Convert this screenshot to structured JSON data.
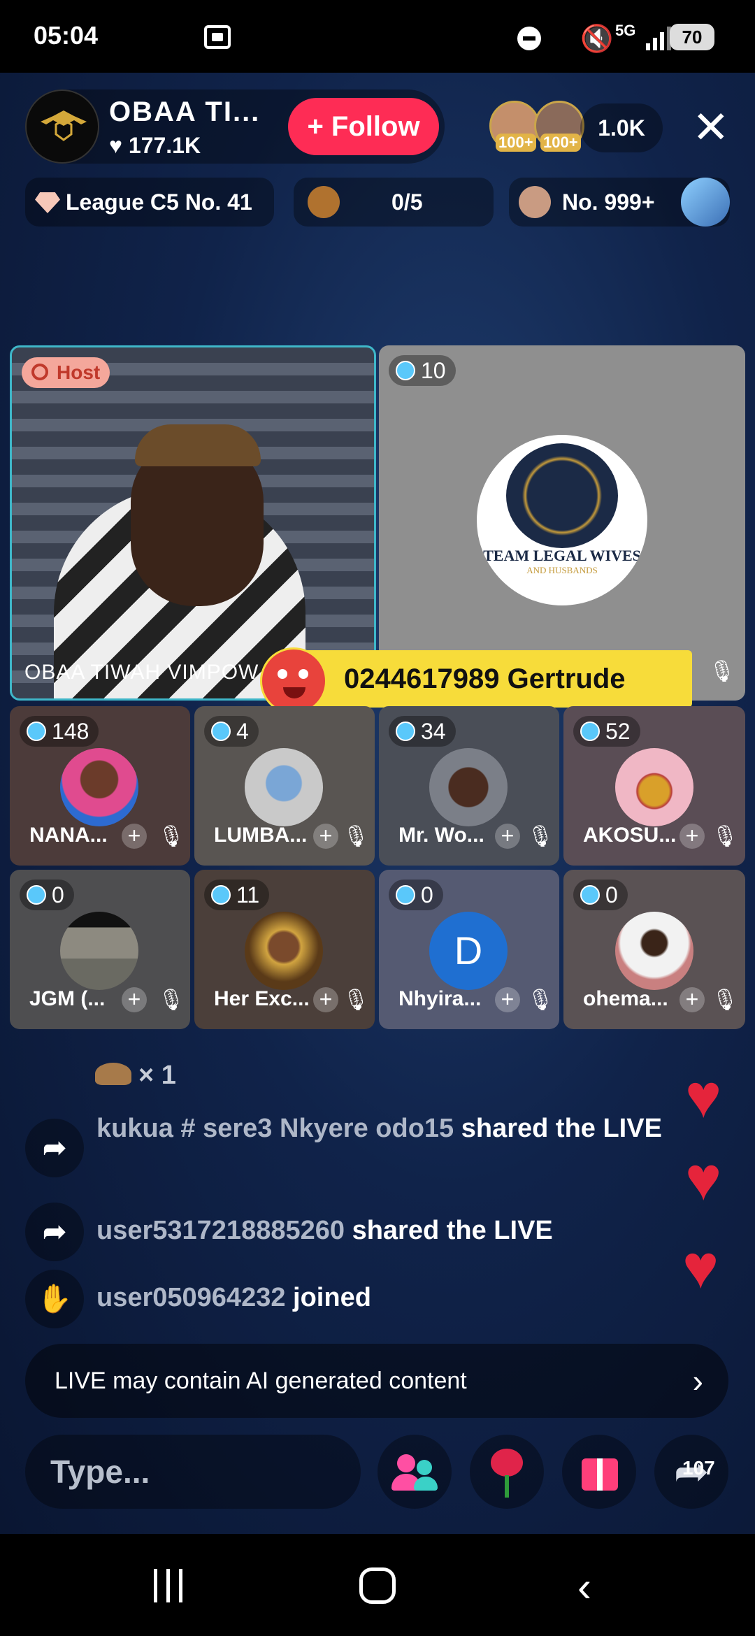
{
  "status_bar": {
    "time": "05:04",
    "network": "5G",
    "battery": "70"
  },
  "host": {
    "name": "OBAA  TI...",
    "likes": "177.1K",
    "follow_label": "+ Follow",
    "avatar_caption": "OBAA TIWAH"
  },
  "viewers": {
    "badge1": "100+",
    "badge2": "100+",
    "count": "1.0K"
  },
  "info": {
    "league": "League C5 No. 41",
    "goal": "0/5",
    "rank": "No. 999+"
  },
  "main_tiles": {
    "host_tag": "Host",
    "host_caption": "OBAA  TIWAH  VIMPOW",
    "guest_score": "10",
    "guest_logo_text": "TEAM LEGAL WIVES",
    "guest_logo_sub": "AND HUSBANDS"
  },
  "pinned_banner": "0244617989 Gertrude",
  "guests": [
    {
      "score": "148",
      "name": "NANA..."
    },
    {
      "score": "4",
      "name": "LUMBA..."
    },
    {
      "score": "34",
      "name": "Mr. Wo..."
    },
    {
      "score": "52",
      "name": "AKOSU..."
    },
    {
      "score": "0",
      "name": "JGM (..."
    },
    {
      "score": "11",
      "name": "Her Exc..."
    },
    {
      "score": "0",
      "name": "Nhyira...",
      "initial": "D"
    },
    {
      "score": "0",
      "name": "ohema..."
    }
  ],
  "chat": {
    "gift_count": "× 1",
    "messages": [
      {
        "user": "kukua # sere3 Nkyere  odo15",
        "action": " shared the LIVE"
      },
      {
        "user": "user5317218885260",
        "action": " shared the LIVE"
      },
      {
        "user": "user050964232",
        "action": " joined"
      }
    ]
  },
  "ai_notice": "LIVE may contain AI generated content",
  "input": {
    "placeholder": "Type..."
  },
  "share_count": "107",
  "colors": {
    "follow": "#fe2c55",
    "banner": "#f7dc3a",
    "background": "#10234a"
  }
}
